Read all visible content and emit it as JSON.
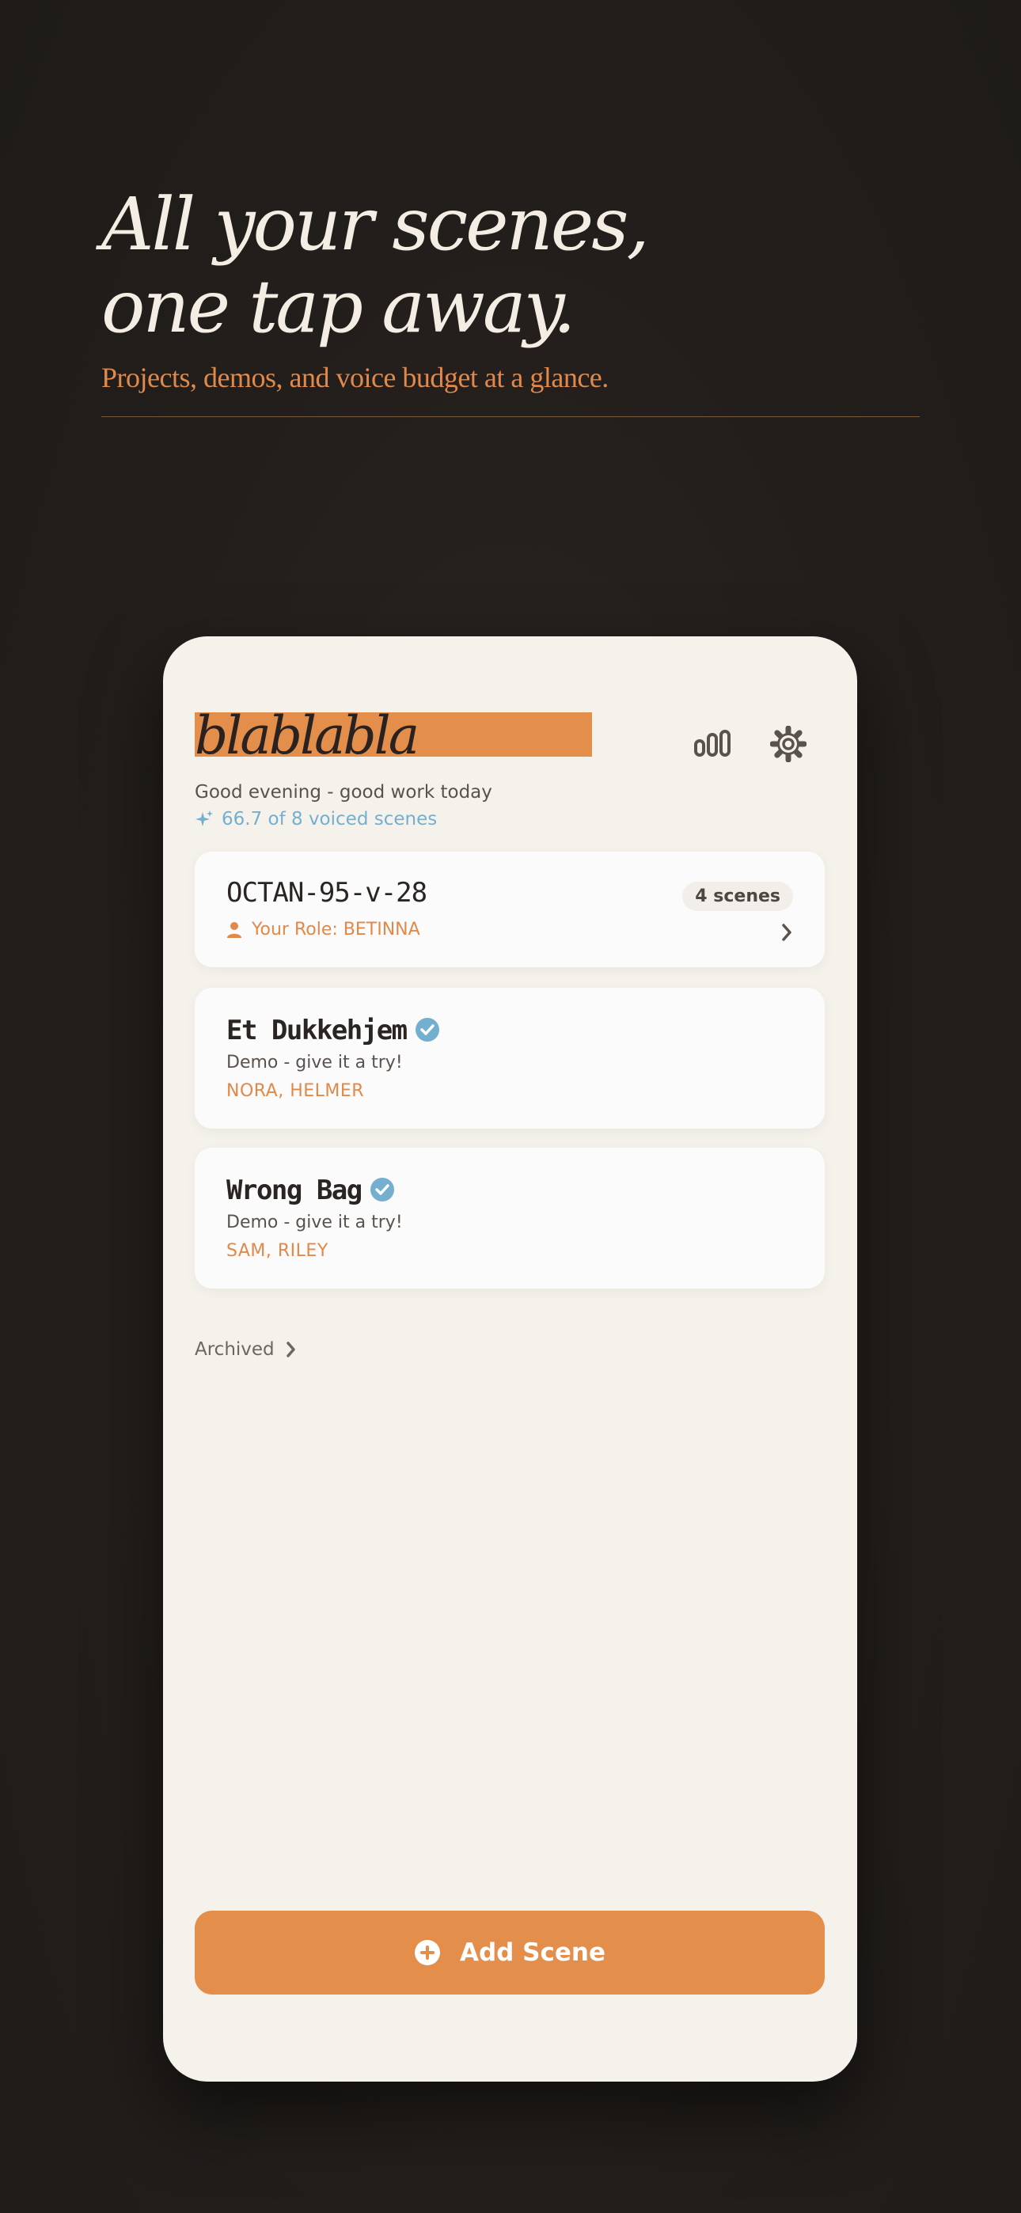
{
  "hero": {
    "headline": "All your scenes,\none tap away.",
    "subheadline": "Projects, demos, and voice budget at a glance."
  },
  "app": {
    "brand": "blablabla",
    "greeting": "Good evening - good work today",
    "voiced_summary": "66.7 of 8 voiced scenes",
    "icons": {
      "stats": "bar-chart-icon",
      "settings": "gear-icon",
      "sparkle": "sparkle-icon",
      "person": "person-icon",
      "verified": "verified-badge-icon",
      "chevron": "chevron-right-icon",
      "add": "plus-circle-icon"
    }
  },
  "projects": [
    {
      "title": "OCTAN-95-v-28",
      "badge": "4 scenes",
      "role": "Your Role: BETINNA"
    },
    {
      "title": "Et Dukkehjem",
      "subtitle": "Demo - give it a try!",
      "cast": "NORA, HELMER"
    },
    {
      "title": "Wrong Bag",
      "subtitle": "Demo - give it a try!",
      "cast": "SAM, RILEY"
    }
  ],
  "archived_label": "Archived",
  "add_button_label": "Add Scene",
  "colors": {
    "accent": "#e38f4b",
    "info_blue": "#74afd0",
    "background_dark": "#221e1b",
    "card_surface": "#f5f2eb"
  }
}
